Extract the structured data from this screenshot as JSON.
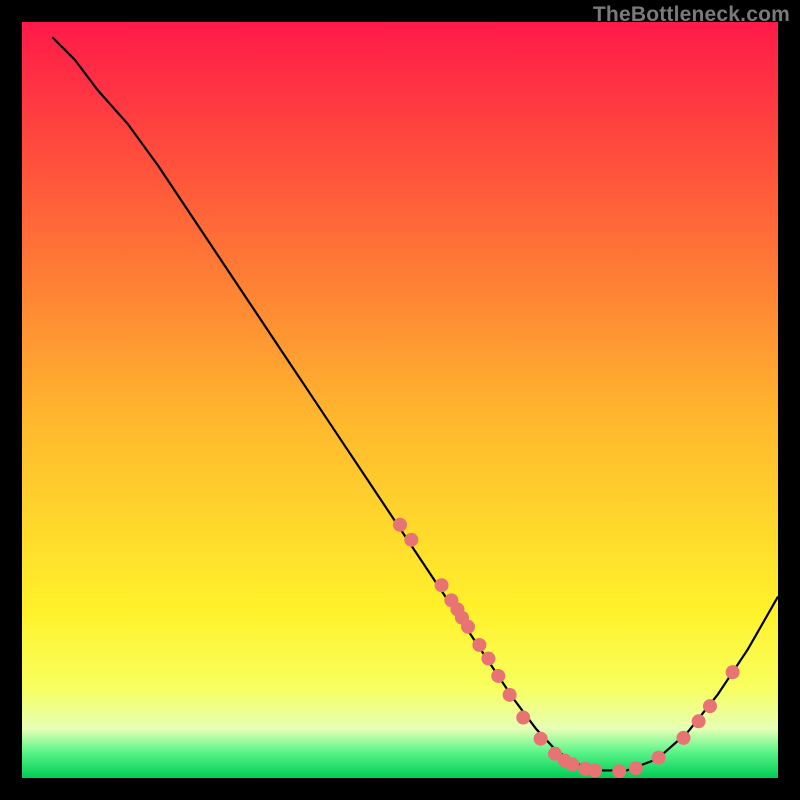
{
  "watermark": "TheBottleneck.com",
  "chart_data": {
    "type": "line",
    "title": "",
    "xlabel": "",
    "ylabel": "",
    "xlim": [
      0,
      100
    ],
    "ylim": [
      0,
      100
    ],
    "grid": false,
    "curve_x": [
      4,
      7,
      10,
      14,
      18,
      22,
      26,
      30,
      34,
      38,
      42,
      46,
      50,
      54,
      58,
      62,
      65,
      68,
      70.5,
      73,
      76,
      80,
      84,
      88,
      92,
      96,
      100
    ],
    "curve_y": [
      98,
      95,
      91,
      86.5,
      81,
      75,
      69,
      63,
      57,
      51,
      45,
      39,
      33,
      27,
      21,
      15,
      10.5,
      6.5,
      3.8,
      2,
      1,
      1,
      2.5,
      6,
      11,
      17,
      24
    ],
    "points": [
      {
        "x": 50,
        "y": 33.5
      },
      {
        "x": 51.5,
        "y": 31.5
      },
      {
        "x": 55.5,
        "y": 25.5
      },
      {
        "x": 56.8,
        "y": 23.5
      },
      {
        "x": 57.6,
        "y": 22.3
      },
      {
        "x": 58.2,
        "y": 21.2
      },
      {
        "x": 59,
        "y": 20
      },
      {
        "x": 60.5,
        "y": 17.6
      },
      {
        "x": 61.7,
        "y": 15.8
      },
      {
        "x": 63,
        "y": 13.5
      },
      {
        "x": 64.5,
        "y": 11
      },
      {
        "x": 66.3,
        "y": 8
      },
      {
        "x": 68.6,
        "y": 5.2
      },
      {
        "x": 70.5,
        "y": 3.2
      },
      {
        "x": 71.8,
        "y": 2.3
      },
      {
        "x": 72.8,
        "y": 1.8
      },
      {
        "x": 74.5,
        "y": 1.2
      },
      {
        "x": 75.8,
        "y": 1
      },
      {
        "x": 79,
        "y": 0.9
      },
      {
        "x": 81.2,
        "y": 1.3
      },
      {
        "x": 84.2,
        "y": 2.7
      },
      {
        "x": 87.5,
        "y": 5.3
      },
      {
        "x": 89.5,
        "y": 7.5
      },
      {
        "x": 91,
        "y": 9.5
      },
      {
        "x": 94,
        "y": 14
      }
    ],
    "point_radius_px": 7
  }
}
